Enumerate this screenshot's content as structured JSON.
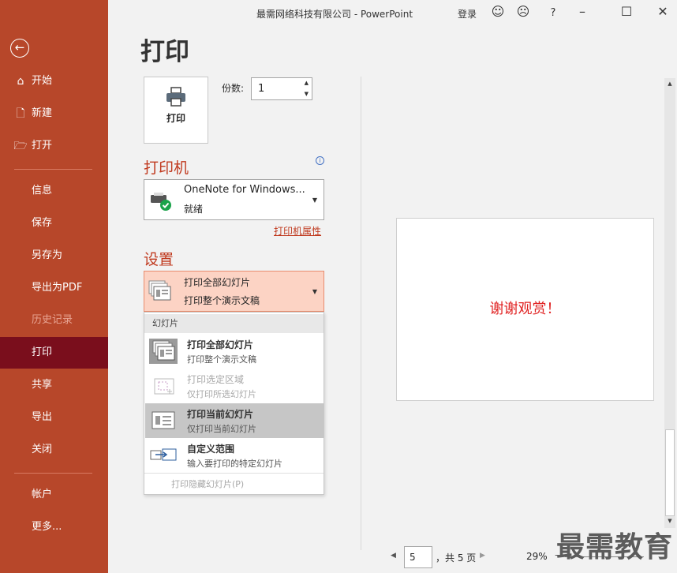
{
  "app": {
    "title": "最需网络科技有限公司 - PowerPoint",
    "login": "登录",
    "help": "?"
  },
  "sidebar": {
    "items": [
      {
        "label": "开始",
        "icon": "home-icon"
      },
      {
        "label": "新建",
        "icon": "new-doc-icon"
      },
      {
        "label": "打开",
        "icon": "folder-open-icon"
      },
      {
        "label": "信息"
      },
      {
        "label": "保存"
      },
      {
        "label": "另存为"
      },
      {
        "label": "导出为PDF"
      },
      {
        "label": "历史记录"
      },
      {
        "label": "打印"
      },
      {
        "label": "共享"
      },
      {
        "label": "导出"
      },
      {
        "label": "关闭"
      },
      {
        "label": "帐户"
      },
      {
        "label": "更多..."
      }
    ]
  },
  "page": {
    "heading": "打印"
  },
  "print": {
    "button_label": "打印",
    "copies_label": "份数:",
    "copies_value": "1"
  },
  "printer": {
    "section": "打印机",
    "name": "OneNote for Windows...",
    "status": "就绪",
    "properties_link": "打印机属性"
  },
  "settings": {
    "section": "设置",
    "dropdown_title": "打印全部幻灯片",
    "dropdown_sub": "打印整个演示文稿",
    "menu_header": "幻灯片",
    "menu_items": [
      {
        "title": "打印全部幻灯片",
        "sub": "打印整个演示文稿"
      },
      {
        "title": "打印选定区域",
        "sub": "仅打印所选幻灯片"
      },
      {
        "title": "打印当前幻灯片",
        "sub": "仅打印当前幻灯片"
      },
      {
        "title": "自定义范围",
        "sub": "输入要打印的特定幻灯片"
      }
    ],
    "hidden_slides": "打印隐藏幻灯片(P)"
  },
  "preview": {
    "slide_text": "谢谢观赏！",
    "page_current": "5",
    "page_total": "，共 5 页",
    "zoom": "29%"
  },
  "watermark": "最需教育",
  "colors": {
    "accent": "#b7472a",
    "selected_nav": "#7a0e1c",
    "section_text": "#c0391e",
    "dropdown_bg": "#fcd3c4"
  }
}
